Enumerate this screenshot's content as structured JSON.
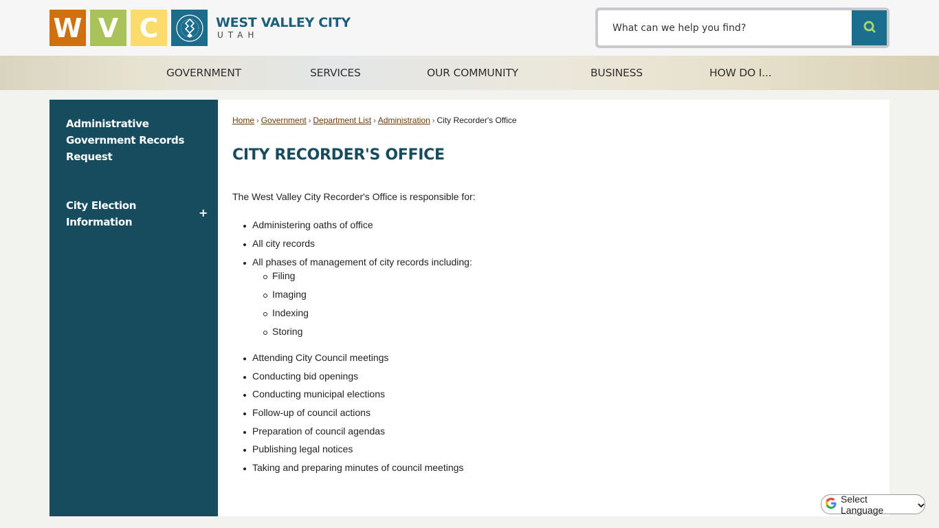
{
  "header": {
    "logo": {
      "tiles": [
        "W",
        "V",
        "C"
      ],
      "title": "WEST VALLEY CITY",
      "subtitle": "UTAH",
      "seal_icon": "city-seal-icon"
    },
    "search": {
      "placeholder": "What can we help you find?",
      "value": "",
      "button_icon": "search-icon"
    }
  },
  "nav": {
    "items": [
      {
        "label": "GOVERNMENT"
      },
      {
        "label": "SERVICES"
      },
      {
        "label": "OUR COMMUNITY"
      },
      {
        "label": "BUSINESS"
      },
      {
        "label": "HOW DO I..."
      }
    ]
  },
  "sidebar": {
    "items": [
      {
        "label": "Administrative Government Records Request",
        "expandable": false
      },
      {
        "label": "City Election Information",
        "expandable": true,
        "expand_icon": "plus-icon"
      }
    ]
  },
  "breadcrumb": {
    "links": [
      "Home",
      "Government",
      "Department List",
      "Administration"
    ],
    "current": "City Recorder's Office",
    "separator": "›"
  },
  "content": {
    "title": "CITY RECORDER'S OFFICE",
    "intro": "The West Valley City Recorder's Office is responsible for:",
    "items": [
      "Administering oaths of office",
      "All city records",
      "All phases of management of city records including:"
    ],
    "subitems": [
      "Filing",
      "Imaging",
      "Indexing",
      "Storing"
    ],
    "items_after": [
      "Attending City Council meetings",
      "Conducting bid openings",
      "Conducting municipal elections",
      "Follow-up of council actions",
      "Preparation of council agendas",
      "Publishing legal notices",
      "Taking and preparing minutes of council meetings"
    ]
  },
  "translate": {
    "label": "Select Language",
    "icon": "google-icon"
  },
  "colors": {
    "brand_teal": "#174c5f",
    "accent_blue": "#1c6e8e",
    "tile_orange": "#d0700f",
    "tile_green": "#a9c25a",
    "tile_yellow": "#fbdb6c",
    "link_brown": "#6b3a0c"
  }
}
